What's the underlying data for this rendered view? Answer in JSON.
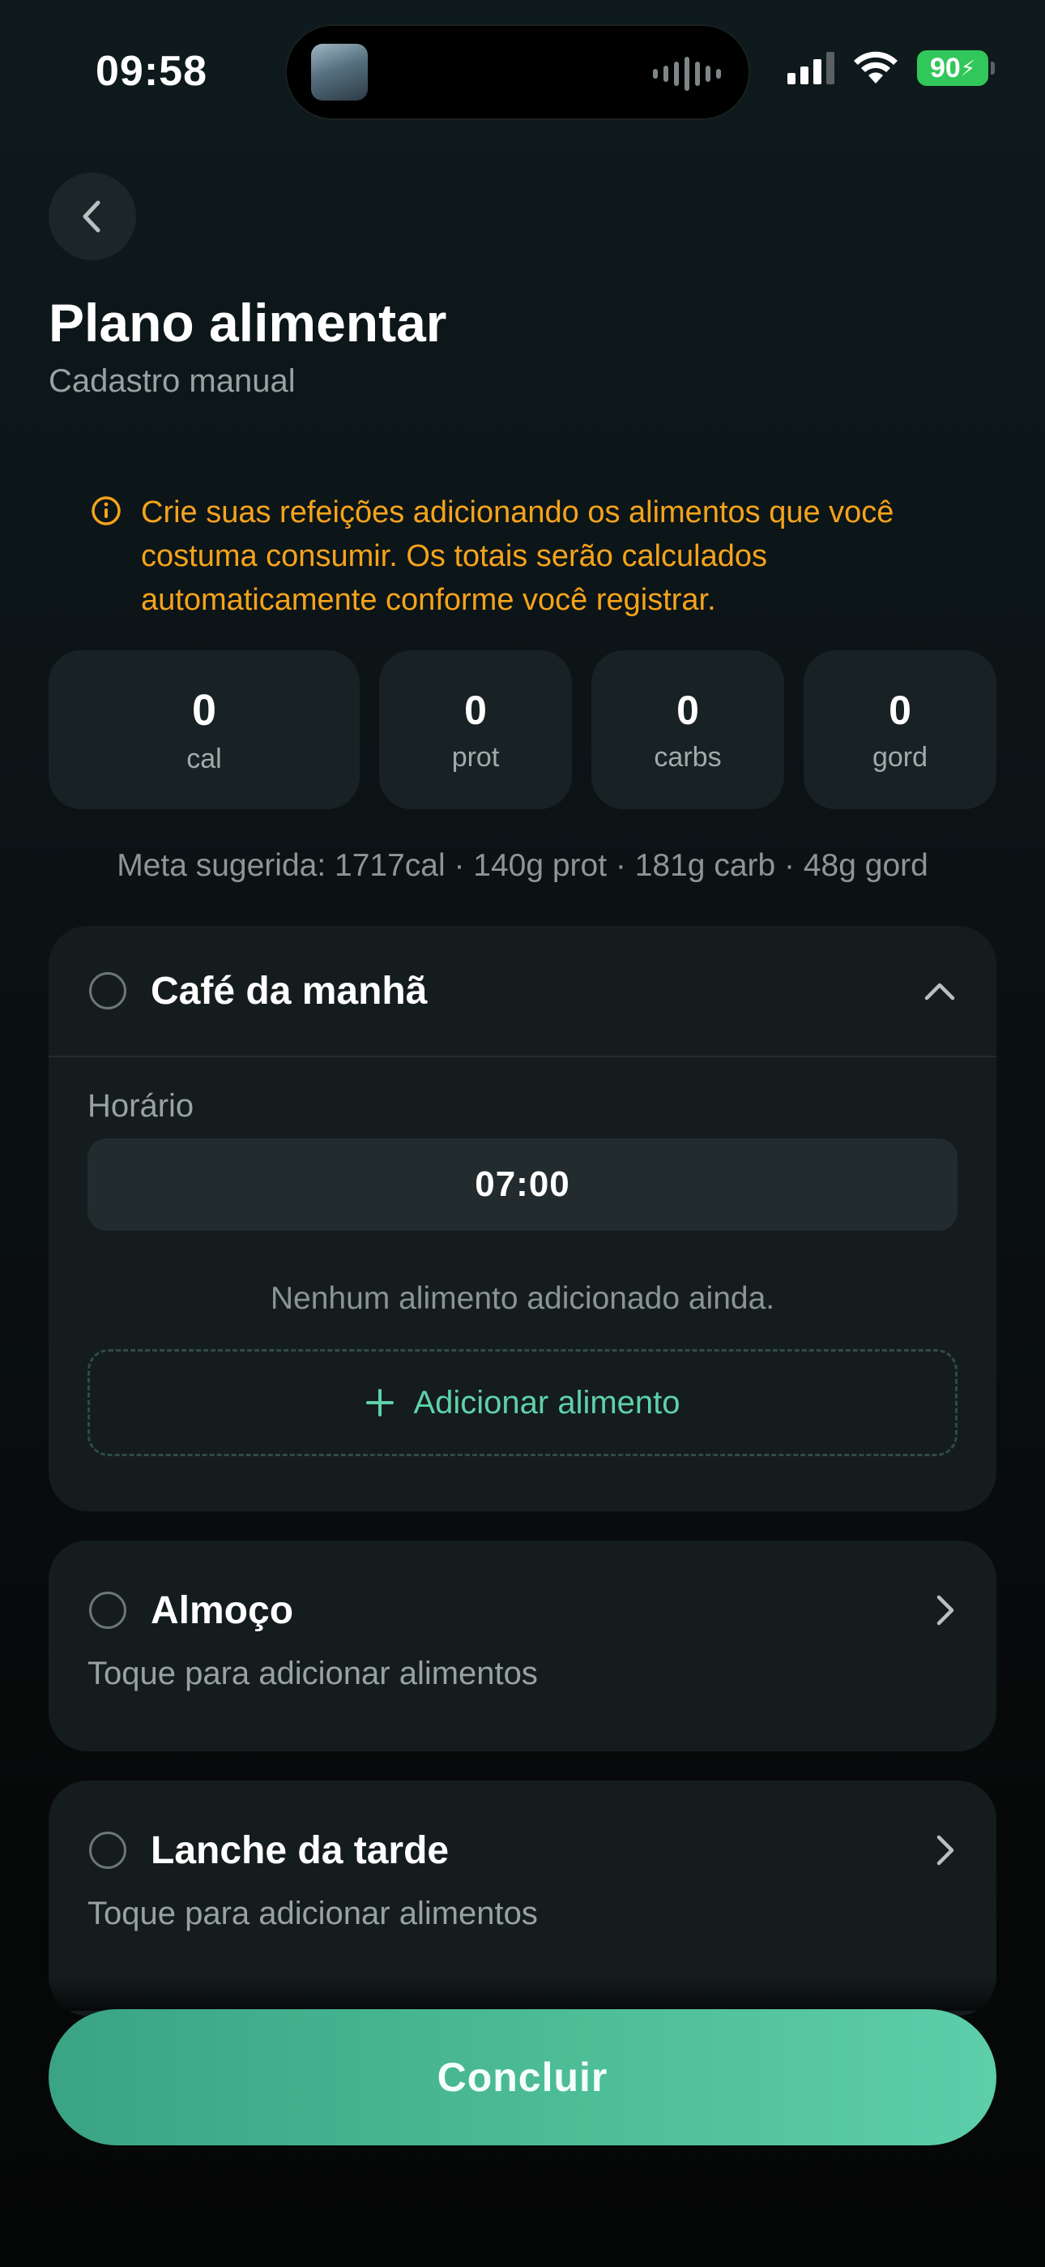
{
  "status_bar": {
    "time": "09:58",
    "battery": "90"
  },
  "header": {
    "title": "Plano alimentar",
    "subtitle": "Cadastro manual"
  },
  "notice": {
    "text": "Crie suas refeições adicionando os alimentos que você costuma consumir. Os totais serão calculados automaticamente conforme você registrar.",
    "color": "#f5a31b"
  },
  "totals": [
    {
      "value": "0",
      "label": "cal"
    },
    {
      "value": "0",
      "label": "prot"
    },
    {
      "value": "0",
      "label": "carbs"
    },
    {
      "value": "0",
      "label": "gord"
    }
  ],
  "goal_text": "Meta sugerida: 1717cal · 140g prot · 181g carb · 48g gord",
  "meals": [
    {
      "name": "Café da manhã",
      "expanded": true,
      "time_label": "Horário",
      "time_value": "07:00",
      "empty_message": "Nenhum alimento adicionado ainda.",
      "add_label": "Adicionar alimento"
    },
    {
      "name": "Almoço",
      "expanded": false,
      "hint": "Toque para adicionar alimentos"
    },
    {
      "name": "Lanche da tarde",
      "expanded": false,
      "hint": "Toque para adicionar alimentos"
    }
  ],
  "primary_button": {
    "label": "Concluir"
  },
  "colors": {
    "accent": "#5fd1a8",
    "button_gradient_start": "#3aa384",
    "button_gradient_end": "#5ccea9"
  }
}
